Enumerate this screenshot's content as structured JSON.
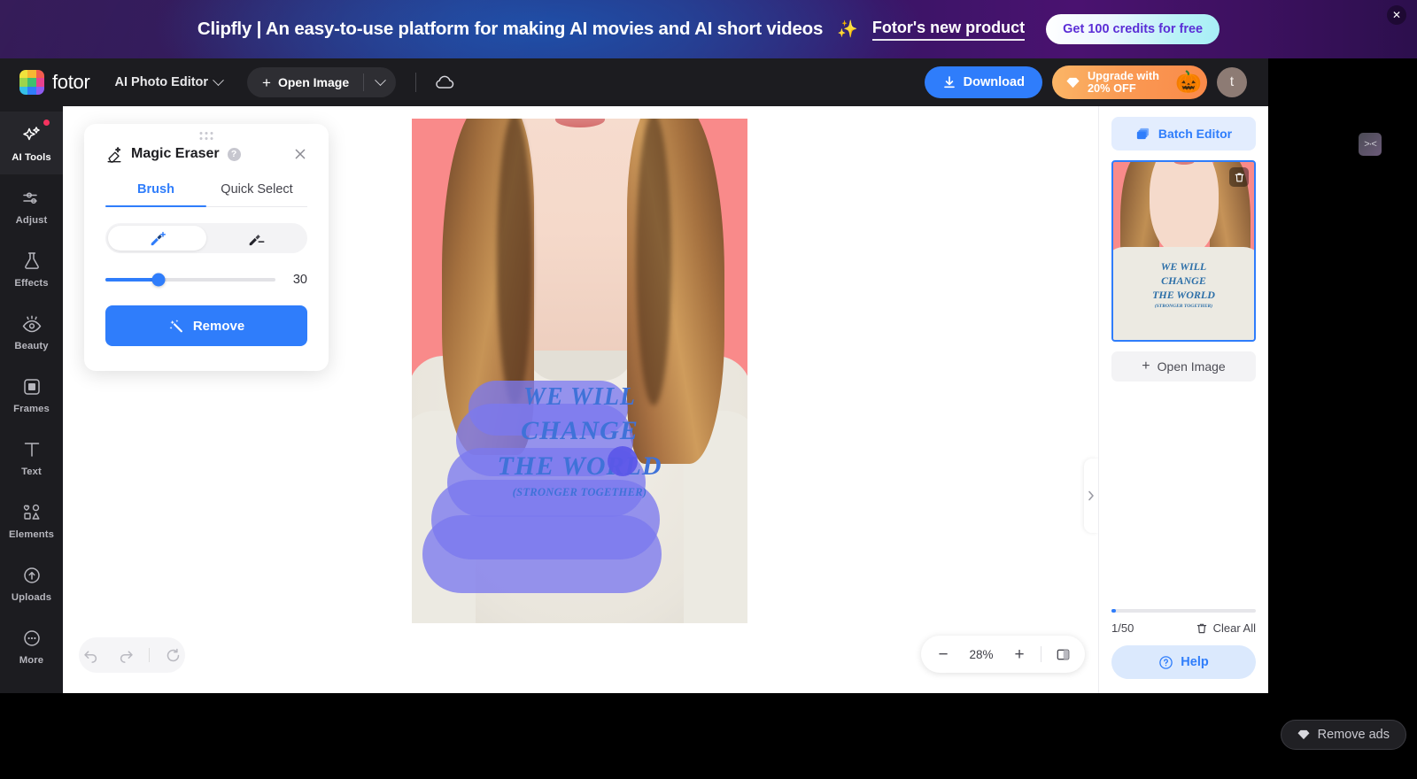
{
  "ad_banner": {
    "text": "Clipfly | An easy-to-use platform for making AI movies and AI short videos",
    "sparkle": "✨",
    "link": "Fotor's new product",
    "cta": "Get 100 credits for free",
    "close_icon": "close-icon",
    "bg_left": "#2b1050",
    "bg_mid": "#26307e",
    "bg_right": "#4a1270"
  },
  "header": {
    "brand": "fotor",
    "mode": "AI Photo Editor",
    "open_image": "Open Image",
    "download": "Download",
    "upgrade_line1": "Upgrade with",
    "upgrade_line2": "20% OFF",
    "pumpkin": "🎃",
    "avatar": "t",
    "cloud_icon": "cloud-icon",
    "download_color": "#2f7dfb",
    "upgrade_color": "#f98a4a"
  },
  "edge_collapse": {
    "icon": ">·<"
  },
  "sidebar": {
    "items": [
      {
        "label": "AI Tools",
        "icon": "sparkle-icon",
        "active": true,
        "badge": true
      },
      {
        "label": "Adjust",
        "icon": "sliders-icon",
        "active": false,
        "badge": false
      },
      {
        "label": "Effects",
        "icon": "flask-icon",
        "active": false,
        "badge": false
      },
      {
        "label": "Beauty",
        "icon": "eye-icon",
        "active": false,
        "badge": false
      },
      {
        "label": "Frames",
        "icon": "frame-icon",
        "active": false,
        "badge": false
      },
      {
        "label": "Text",
        "icon": "text-t-icon",
        "active": false,
        "badge": false
      },
      {
        "label": "Elements",
        "icon": "shapes-icon",
        "active": false,
        "badge": false
      },
      {
        "label": "Uploads",
        "icon": "cloud-upload-icon",
        "active": false,
        "badge": false
      },
      {
        "label": "More",
        "icon": "ellipsis-circle-icon",
        "active": false,
        "badge": false
      }
    ]
  },
  "magic_eraser": {
    "title": "Magic Eraser",
    "help_glyph": "?",
    "close_icon": "close-icon",
    "eraser_icon": "magic-eraser-icon",
    "tabs": [
      {
        "label": "Brush",
        "active": true
      },
      {
        "label": "Quick Select",
        "active": false
      }
    ],
    "brush_modes": [
      {
        "icon": "brush-add-icon",
        "active": true
      },
      {
        "icon": "brush-erase-icon",
        "active": false
      }
    ],
    "brush_size": "30",
    "brush_size_percent": 31,
    "remove_label": "Remove",
    "remove_icon": "magic-wand-icon",
    "accent": "#2f7dfb"
  },
  "canvas": {
    "shirt_print": {
      "line1": "WE WILL",
      "line2": "CHANGE",
      "line3": "THE WORLD",
      "line4": "(STRONGER TOGETHER)"
    },
    "mask_color": "#7b78ee",
    "cursor_color": "#5b57e8"
  },
  "bottom_bar": {
    "undo_icon": "undo-icon",
    "redo_icon": "redo-icon",
    "reset_icon": "reset-icon",
    "zoom_out": "−",
    "zoom_value": "28%",
    "zoom_in": "+",
    "compare_icon": "compare-split-icon"
  },
  "panel_handle": {
    "icon": "chevron-right-icon"
  },
  "right_panel": {
    "batch_editor": "Batch Editor",
    "batch_icon": "layers-icon",
    "thumb_delete_icon": "trash-icon",
    "thumb_print": {
      "line1": "WE WILL",
      "line2": "CHANGE",
      "line3": "THE WORLD",
      "line4": "(STRONGER TOGETHER)"
    },
    "open_image": "Open Image",
    "count": "1/50",
    "clear_all": "Clear All",
    "clear_icon": "trash-icon",
    "help": "Help",
    "help_icon": "question-circle-icon",
    "accent": "#2f7dfb"
  },
  "remove_ads": {
    "label": "Remove ads",
    "icon": "diamond-icon"
  }
}
